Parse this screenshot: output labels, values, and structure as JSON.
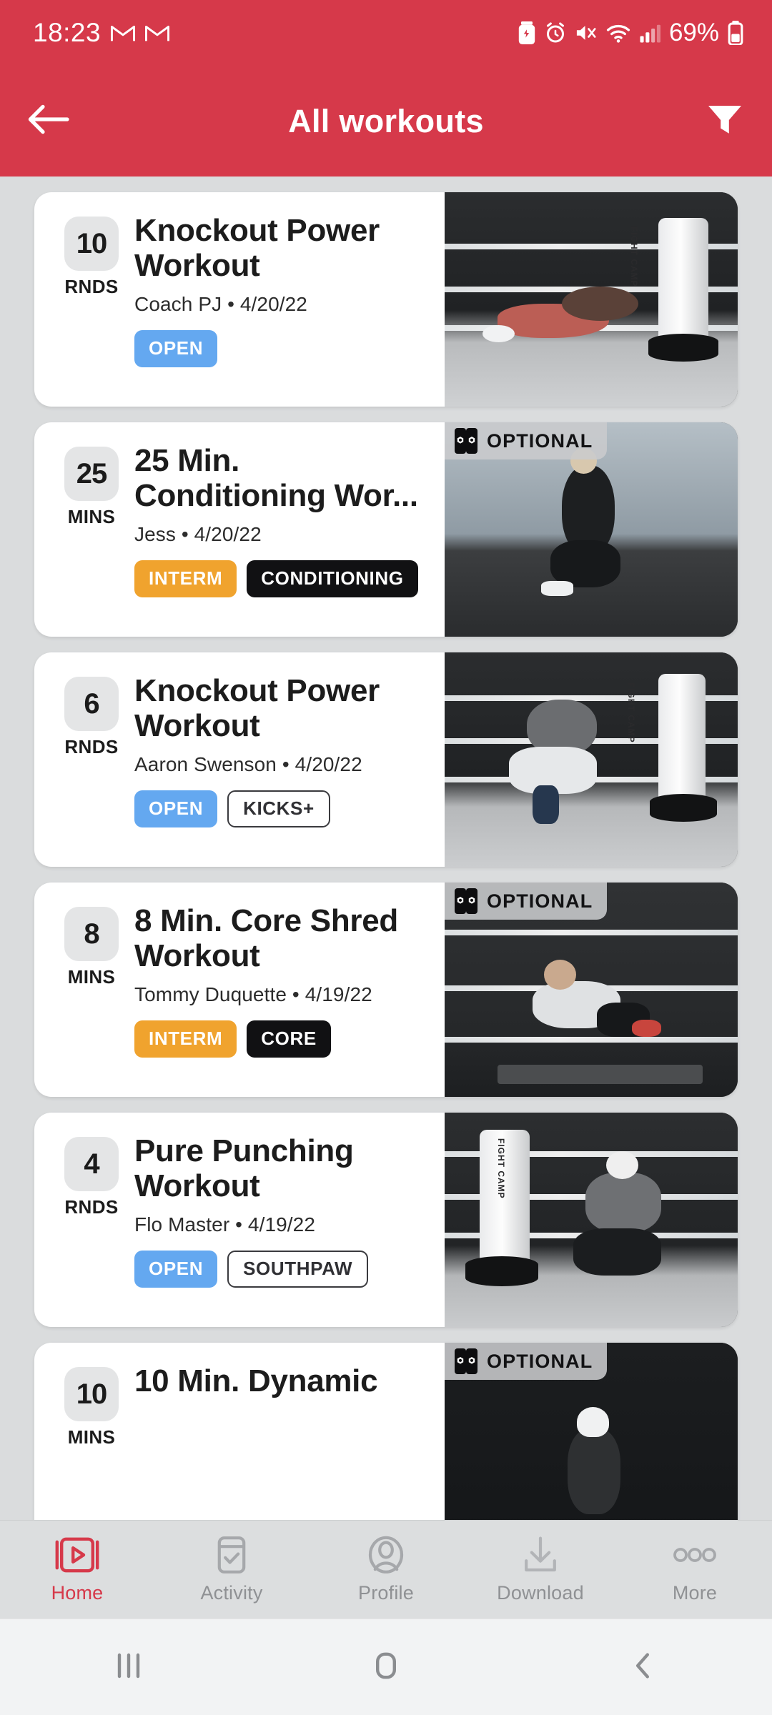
{
  "status_bar": {
    "time": "18:23",
    "battery_percent": "69%",
    "icons": [
      "gmail-icon",
      "gmail-icon",
      "battery-saver-icon",
      "alarm-icon",
      "mute-icon",
      "wifi-icon",
      "cellular-signal-icon",
      "battery-icon"
    ]
  },
  "app_bar": {
    "title": "All workouts",
    "back_icon": "back-arrow-icon",
    "filter_icon": "filter-funnel-icon"
  },
  "theme": {
    "header_red": "#d6394a",
    "page_background": "#dadcdd",
    "card_white": "#ffffff",
    "badge_open_blue": "#64a8f0",
    "badge_interm_orange": "#f0a32e",
    "badge_dark": "#111113",
    "nav_active_red": "#d6394a",
    "nav_inactive_gray": "#8f9194"
  },
  "workouts": [
    {
      "count": "10",
      "unit": "RNDS",
      "title": "Knockout Power Workout",
      "instructor": "Coach PJ",
      "date": "4/20/22",
      "byline": "Coach PJ • 4/20/22",
      "badges": [
        {
          "label": "OPEN",
          "style": "open"
        }
      ],
      "optional": null,
      "photo": "boxer-plank-punch-bag"
    },
    {
      "count": "25",
      "unit": "MINS",
      "title": "25 Min. Conditioning Wor...",
      "instructor": "Jess",
      "date": "4/20/22",
      "byline": "Jess • 4/20/22",
      "badges": [
        {
          "label": "INTERM",
          "style": "interm"
        },
        {
          "label": "CONDITIONING",
          "style": "dark"
        }
      ],
      "optional": "OPTIONAL",
      "photo": "woman-jumping-conditioning"
    },
    {
      "count": "6",
      "unit": "RNDS",
      "title": "Knockout Power Workout",
      "instructor": "Aaron Swenson",
      "date": "4/20/22",
      "byline": "Aaron Swenson • 4/20/22",
      "badges": [
        {
          "label": "OPEN",
          "style": "open"
        },
        {
          "label": "KICKS+",
          "style": "outline"
        }
      ],
      "optional": null,
      "photo": "fighter-high-kick-bag"
    },
    {
      "count": "8",
      "unit": "MINS",
      "title": "8 Min. Core Shred Workout",
      "instructor": "Tommy Duquette",
      "date": "4/19/22",
      "byline": "Tommy Duquette • 4/19/22",
      "badges": [
        {
          "label": "INTERM",
          "style": "interm"
        },
        {
          "label": "CORE",
          "style": "dark"
        }
      ],
      "optional": "OPTIONAL",
      "photo": "man-situp-core-mat"
    },
    {
      "count": "4",
      "unit": "RNDS",
      "title": "Pure Punching Workout",
      "instructor": "Flo Master",
      "date": "4/19/22",
      "byline": "Flo Master • 4/19/22",
      "badges": [
        {
          "label": "OPEN",
          "style": "open"
        },
        {
          "label": "SOUTHPAW",
          "style": "outline"
        }
      ],
      "optional": null,
      "photo": "boxer-punching-bag"
    },
    {
      "count": "10",
      "unit": "MINS",
      "title": "10 Min. Dynamic",
      "instructor": "",
      "date": "",
      "byline": "",
      "badges": [],
      "optional": "OPTIONAL",
      "photo": "man-warmup-dark"
    }
  ],
  "bottom_nav": {
    "items": [
      {
        "label": "Home",
        "icon": "play-video-icon",
        "active": true
      },
      {
        "label": "Activity",
        "icon": "checklist-icon",
        "active": false
      },
      {
        "label": "Profile",
        "icon": "person-icon",
        "active": false
      },
      {
        "label": "Download",
        "icon": "download-arrow-icon",
        "active": false
      },
      {
        "label": "More",
        "icon": "more-dots-icon",
        "active": false
      }
    ]
  },
  "system_nav": {
    "recents_icon": "recents-bars-icon",
    "home_icon": "home-square-icon",
    "back_icon": "back-chevron-icon"
  }
}
